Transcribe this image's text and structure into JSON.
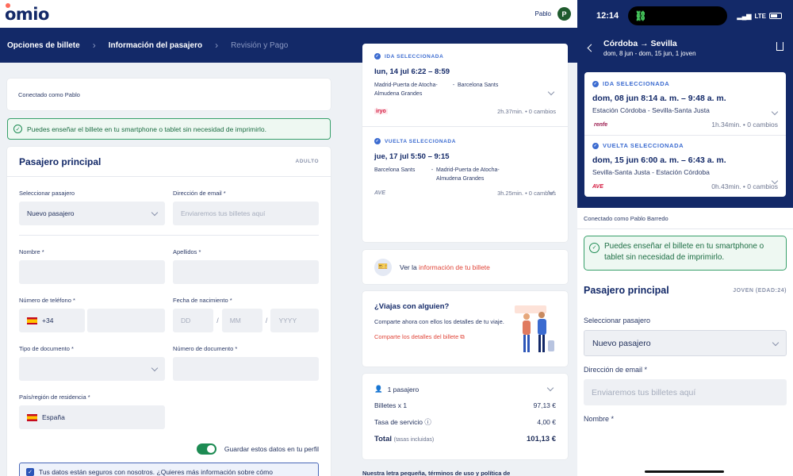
{
  "brand": {
    "logo": "omio"
  },
  "user": {
    "name": "Pablo",
    "initial": "P"
  },
  "steps": [
    "Opciones de billete",
    "Información del pasajero",
    "Revisión y Pago"
  ],
  "left": {
    "logged_in": "Conectado como Pablo",
    "notice": "Puedes enseñar el billete en tu smartphone o tablet sin necesidad de imprimirlo.",
    "form_title": "Pasajero principal",
    "form_badge": "ADULTO",
    "fields": {
      "select_passenger_label": "Seleccionar pasajero",
      "select_passenger_value": "Nuevo pasajero",
      "email_label": "Dirección de email *",
      "email_placeholder": "Enviaremos tus billetes aquí",
      "name_label": "Nombre *",
      "surname_label": "Apellidos *",
      "phone_label": "Número de teléfono *",
      "phone_prefix": "+34",
      "dob_label": "Fecha de nacimiento *",
      "dob_dd": "DD",
      "dob_mm": "MM",
      "dob_yyyy": "YYYY",
      "doc_type_label": "Tipo de documento *",
      "doc_number_label": "Número de documento *",
      "country_label": "País/región de residencia *",
      "country_value": "España"
    },
    "save_toggle": "Guardar estos datos en tu perfil",
    "secure_text": "Tus datos están seguros con nosotros. ¿Quieres más información sobre cómo"
  },
  "outbound": {
    "label": "IDA SELECCIONADA",
    "date_time": "lun, 14 jul   6:22 – 8:59",
    "from": "Madrid-Puerta de Atocha-Almudena Grandes",
    "to": "Barcelona Sants",
    "operator": "iryo",
    "duration": "2h.37min. • 0 cambios"
  },
  "return": {
    "label": "VUELTA SELECCIONADA",
    "date_time": "jue, 17 jul   5:50 – 9:15",
    "from": "Barcelona Sants",
    "to": "Madrid-Puerta de Atocha-Almudena Grandes",
    "operator": "AVE",
    "duration": "3h.25min. • 0 cambios"
  },
  "ticket_info": {
    "prefix": "Ver la ",
    "link": "información de tu billete"
  },
  "share": {
    "title": "¿Viajas con alguien?",
    "text": "Comparte ahora con ellos los detalles de tu viaje.",
    "link": "Comparte los detalles del billete"
  },
  "price": {
    "passengers": "1 pasajero",
    "rows": [
      {
        "label": "Billetes x 1",
        "value": "97,13 €"
      },
      {
        "label": "Tasa de servicio",
        "value": "4,00 €"
      }
    ],
    "total_label": "Total",
    "total_note": "(tasas incluidas)",
    "total_value": "101,13 €"
  },
  "fine_print": "Nuestra letra pequeña, términos de uso y política de",
  "phone": {
    "time": "12:14",
    "network": "LTE",
    "route": "Córdoba → Sevilla",
    "dates": "dom, 8 jun - dom, 15 jun, 1 joven",
    "outbound": {
      "label": "IDA SELECCIONADA",
      "date_time": "dom, 08 jun   8:14 a. m. – 9:48 a. m.",
      "stations": "Estación Córdoba  -  Sevilla-Santa Justa",
      "operator": "renfe",
      "duration": "1h.34min. • 0 cambios"
    },
    "return": {
      "label": "VUELTA SELECCIONADA",
      "date_time": "dom, 15 jun   6:00 a. m. – 6:43 a. m.",
      "stations": "Sevilla-Santa Justa  -  Estación Córdoba",
      "operator": "AVE",
      "duration": "0h.43min. • 0 cambios"
    },
    "logged_in": "Conectado como Pablo Barredo",
    "notice": "Puedes enseñar el billete en tu smartphone o tablet sin necesidad de imprimirlo.",
    "form_title": "Pasajero principal",
    "form_badge": "JOVEN (EDAD:24)",
    "select_label": "Seleccionar pasajero",
    "select_value": "Nuevo pasajero",
    "email_label": "Dirección de email *",
    "email_placeholder": "Enviaremos tus billetes aquí",
    "name_label": "Nombre *"
  }
}
